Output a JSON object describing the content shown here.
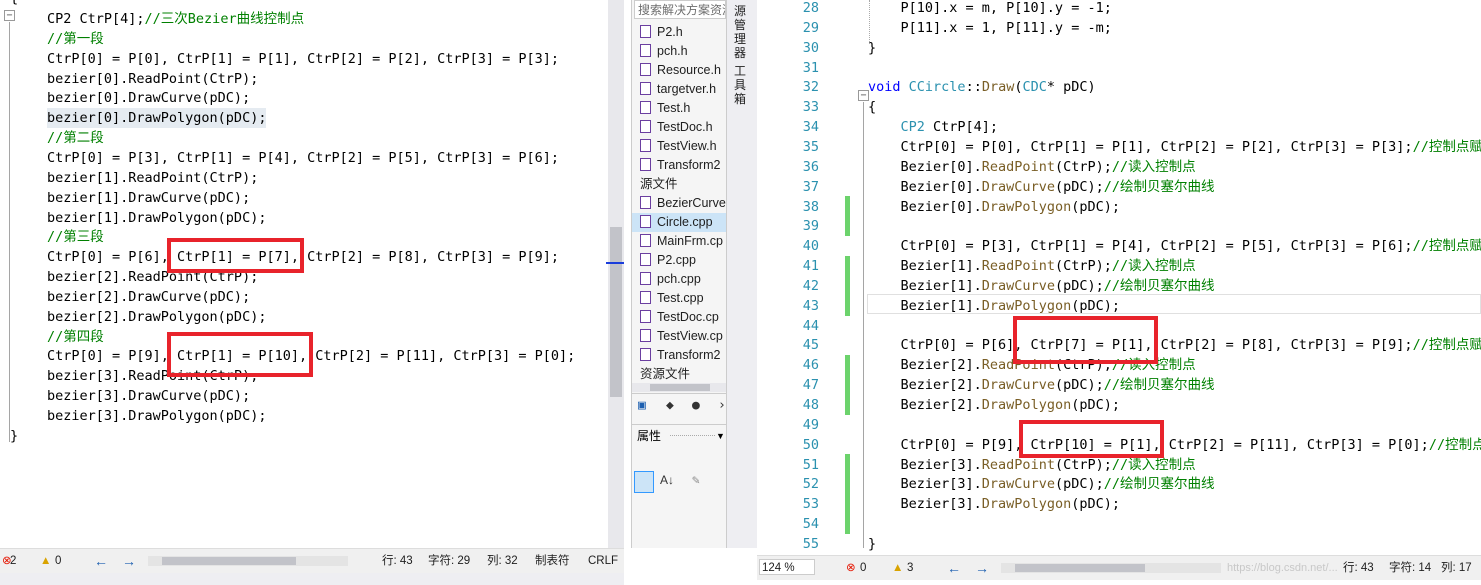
{
  "left_editor": {
    "lines": [
      {
        "t": "CP2 CtrP[4];",
        "c": "//三次Bezier曲线控制点"
      },
      {
        "t": "",
        "c": "//第一段"
      },
      {
        "t": "CtrP[0] = P[0], CtrP[1] = P[1], CtrP[2] = P[2], CtrP[3] = P[3];",
        "c": ""
      },
      {
        "t": "bezier[0].ReadPoint(CtrP);",
        "c": ""
      },
      {
        "t": "bezier[0].DrawCurve(pDC);",
        "c": ""
      },
      {
        "t": "bezier[0].DrawPolygon(pDC);",
        "c": ""
      },
      {
        "t": "",
        "c": "//第二段"
      },
      {
        "t": "CtrP[0] = P[3], CtrP[1] = P[4], CtrP[2] = P[5], CtrP[3] = P[6];",
        "c": ""
      },
      {
        "t": "bezier[1].ReadPoint(CtrP);",
        "c": ""
      },
      {
        "t": "bezier[1].DrawCurve(pDC);",
        "c": ""
      },
      {
        "t": "bezier[1].DrawPolygon(pDC);",
        "c": ""
      },
      {
        "t": "",
        "c": "//第三段"
      },
      {
        "t": "CtrP[0] = P[6], CtrP[1] = P[7], CtrP[2] = P[8], CtrP[3] = P[9];",
        "c": ""
      },
      {
        "t": "bezier[2].ReadPoint(CtrP);",
        "c": ""
      },
      {
        "t": "bezier[2].DrawCurve(pDC);",
        "c": ""
      },
      {
        "t": "bezier[2].DrawPolygon(pDC);",
        "c": ""
      },
      {
        "t": "",
        "c": "//第四段"
      },
      {
        "t": "CtrP[0] = P[9], CtrP[1] = P[10], CtrP[2] = P[11], CtrP[3] = P[0];",
        "c": ""
      },
      {
        "t": "bezier[3].ReadPoint(CtrP);",
        "c": ""
      },
      {
        "t": "bezier[3].DrawCurve(pDC);",
        "c": ""
      },
      {
        "t": "bezier[3].DrawPolygon(pDC);",
        "c": ""
      }
    ],
    "closing_brace": "}",
    "opening_brace": "{",
    "status": {
      "errors": "2",
      "warnings": "0",
      "row": "行: 43",
      "char": "字符: 29",
      "col": "列: 32",
      "tab": "制表符",
      "eol": "CRLF"
    }
  },
  "solution_explorer": {
    "search_placeholder": "搜索解决方案资源",
    "items": [
      {
        "label": "P2.h",
        "type": "h"
      },
      {
        "label": "pch.h",
        "type": "h"
      },
      {
        "label": "Resource.h",
        "type": "h"
      },
      {
        "label": "targetver.h",
        "type": "h"
      },
      {
        "label": "Test.h",
        "type": "h"
      },
      {
        "label": "TestDoc.h",
        "type": "h"
      },
      {
        "label": "TestView.h",
        "type": "h"
      },
      {
        "label": "Transform2",
        "type": "h"
      },
      {
        "label": "源文件",
        "type": "folder"
      },
      {
        "label": "BezierCurve",
        "type": "cpp"
      },
      {
        "label": "Circle.cpp",
        "type": "cpp"
      },
      {
        "label": "MainFrm.cp",
        "type": "cpp"
      },
      {
        "label": "P2.cpp",
        "type": "cpp"
      },
      {
        "label": "pch.cpp",
        "type": "cpp"
      },
      {
        "label": "Test.cpp",
        "type": "cpp"
      },
      {
        "label": "TestDoc.cp",
        "type": "cpp"
      },
      {
        "label": "TestView.cp",
        "type": "cpp"
      },
      {
        "label": "Transform2",
        "type": "cpp"
      },
      {
        "label": "资源文件",
        "type": "folder"
      }
    ],
    "properties_label": "属性",
    "side_tabs": [
      "源管理器",
      "工具箱"
    ]
  },
  "right_editor": {
    "lines": [
      {
        "n": "28",
        "t": "    P[10].x = m, P[10].y = -1;"
      },
      {
        "n": "29",
        "t": "    P[11].x = 1, P[11].y = -m;"
      },
      {
        "n": "30",
        "t": "}"
      },
      {
        "n": "31",
        "t": ""
      },
      {
        "n": "32",
        "t": "void CCircle::Draw(CDC* pDC)"
      },
      {
        "n": "33",
        "t": "{"
      },
      {
        "n": "34",
        "t": "    CP2 CtrP[4];"
      },
      {
        "n": "35",
        "t": "    CtrP[0] = P[0], CtrP[1] = P[1], CtrP[2] = P[2], CtrP[3] = P[3];//控制点赋"
      },
      {
        "n": "36",
        "t": "    Bezier[0].ReadPoint(CtrP);//读入控制点"
      },
      {
        "n": "37",
        "t": "    Bezier[0].DrawCurve(pDC);//绘制贝塞尔曲线"
      },
      {
        "n": "38",
        "t": "    Bezier[0].DrawPolygon(pDC);"
      },
      {
        "n": "39",
        "t": ""
      },
      {
        "n": "40",
        "t": "    CtrP[0] = P[3], CtrP[1] = P[4], CtrP[2] = P[5], CtrP[3] = P[6];//控制点赋"
      },
      {
        "n": "41",
        "t": "    Bezier[1].ReadPoint(CtrP);//读入控制点"
      },
      {
        "n": "42",
        "t": "    Bezier[1].DrawCurve(pDC);//绘制贝塞尔曲线"
      },
      {
        "n": "43",
        "t": "    Bezier[1].DrawPolygon(pDC);"
      },
      {
        "n": "44",
        "t": ""
      },
      {
        "n": "45",
        "t": "    CtrP[0] = P[6], CtrP[7] = P[1], CtrP[2] = P[8], CtrP[3] = P[9];//控制点赋"
      },
      {
        "n": "46",
        "t": "    Bezier[2].ReadPoint(CtrP);//读入控制点"
      },
      {
        "n": "47",
        "t": "    Bezier[2].DrawCurve(pDC);//绘制贝塞尔曲线"
      },
      {
        "n": "48",
        "t": "    Bezier[2].DrawPolygon(pDC);"
      },
      {
        "n": "49",
        "t": ""
      },
      {
        "n": "50",
        "t": "    CtrP[0] = P[9], CtrP[10] = P[1], CtrP[2] = P[11], CtrP[3] = P[0];//控制点"
      },
      {
        "n": "51",
        "t": "    Bezier[3].ReadPoint(CtrP);//读入控制点"
      },
      {
        "n": "52",
        "t": "    Bezier[3].DrawCurve(pDC);//绘制贝塞尔曲线"
      },
      {
        "n": "53",
        "t": "    Bezier[3].DrawPolygon(pDC);"
      },
      {
        "n": "54",
        "t": ""
      },
      {
        "n": "55",
        "t": "}"
      }
    ],
    "status": {
      "zoom": "124 %",
      "errors": "0",
      "warnings": "3",
      "row": "行: 43",
      "char": "字符: 14",
      "col": "列: 17"
    },
    "watermark": "https://blog.csdn.net/..."
  },
  "colors": {
    "comment": "#008000",
    "type": "#2b91af",
    "keyword": "#0000ff",
    "highlight_box": "#e8232b",
    "change_bar": "#6cd36c"
  }
}
